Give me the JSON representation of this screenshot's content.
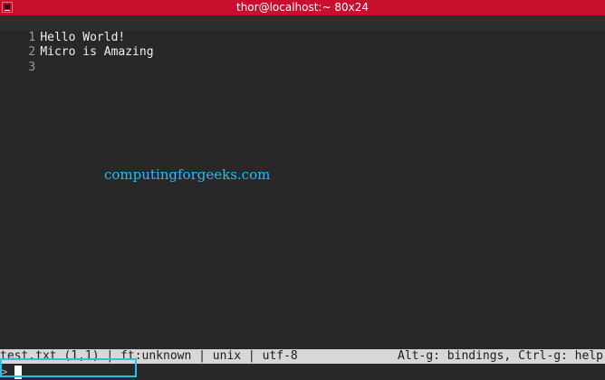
{
  "window": {
    "title": "thor@localhost:~ 80x24"
  },
  "editor": {
    "lines": [
      {
        "number": "1",
        "text": "Hello World!"
      },
      {
        "number": "2",
        "text": "Micro is Amazing"
      },
      {
        "number": "3",
        "text": ""
      }
    ]
  },
  "watermark": "computingforgeeks.com",
  "statusbar": {
    "left": "test.txt (1,1) | ft:unknown | unix | utf-8",
    "right": "Alt-g: bindings, Ctrl-g: help"
  },
  "command": {
    "prompt": ">"
  },
  "colors": {
    "titlebar": "#c8102e",
    "background": "#282828",
    "statusbar": "#d7d7d7",
    "watermark": "#1ec0ff",
    "highlight": "#2cc0e8"
  },
  "icons": {
    "window": "terminal-icon"
  }
}
